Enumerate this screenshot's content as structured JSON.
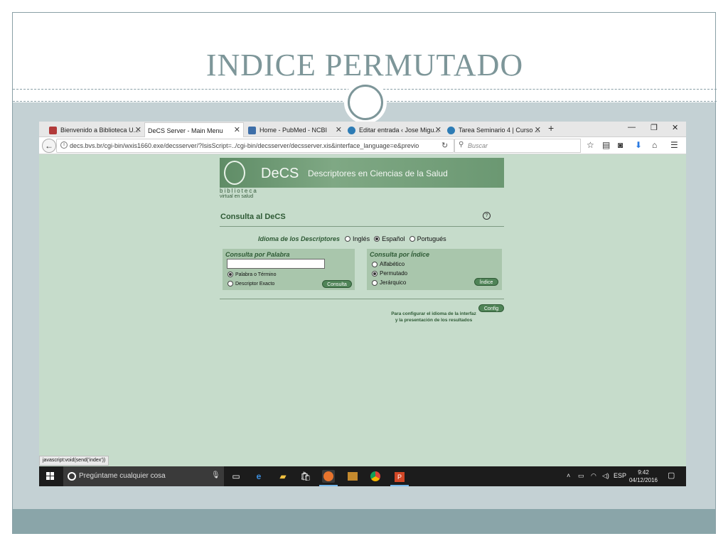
{
  "slide": {
    "title": "INDICE PERMUTADO"
  },
  "browser": {
    "tabs": [
      {
        "label": "Bienvenido a Biblioteca U...",
        "fav_color": "#b23a3a"
      },
      {
        "label": "DeCS Server - Main Menu",
        "fav_color": "#ffffff"
      },
      {
        "label": "Home - PubMed - NCBI",
        "fav_color": "#3d6ea8"
      },
      {
        "label": "Editar entrada ‹ Jose Migu...",
        "fav_color": "#2d7cb5"
      },
      {
        "label": "Tarea Seminario 4 | Curso ...",
        "fav_color": "#2d7cb5"
      }
    ],
    "new_tab": "+",
    "window_controls": {
      "minimize": "—",
      "restore": "❐",
      "close": "✕"
    },
    "url": "decs.bvs.br/cgi-bin/wxis1660.exe/decsserver/?IsisScript=../cgi-bin/decsserver/decsserver.xis&interface_language=e&previo",
    "search_placeholder": "Buscar",
    "status_text": "javascript:void(send('index'))"
  },
  "decs": {
    "banner_brand": "DeCS",
    "banner_subtitle": "Descriptores en Ciencias de la Salud",
    "biblio_line1": "biblioteca",
    "biblio_line2": "virtual en salud",
    "heading": "Consulta al DeCS",
    "help_symbol": "?",
    "language_label": "Idioma de los Descriptores",
    "languages": [
      "Inglés",
      "Español",
      "Portugués"
    ],
    "selected_language": "Español",
    "word_panel": {
      "title": "Consulta por Palabra",
      "input_value": "",
      "options": [
        "Palabra o Término",
        "Descriptor Exacto"
      ],
      "selected": "Palabra o Término",
      "button": "Consulta"
    },
    "index_panel": {
      "title": "Consulta por Índice",
      "options": [
        "Alfabético",
        "Permutado",
        "Jerárquico"
      ],
      "selected": "Permutado",
      "button": "Índice"
    },
    "config_button": "Config",
    "config_note_line1": "Para configurar el idioma de la interfaz",
    "config_note_line2": "y la presentación de los resultados"
  },
  "taskbar": {
    "search_placeholder": "Pregúntame cualquier cosa",
    "tray_lang": "ESP",
    "time": "9:42",
    "date": "04/12/2016"
  }
}
